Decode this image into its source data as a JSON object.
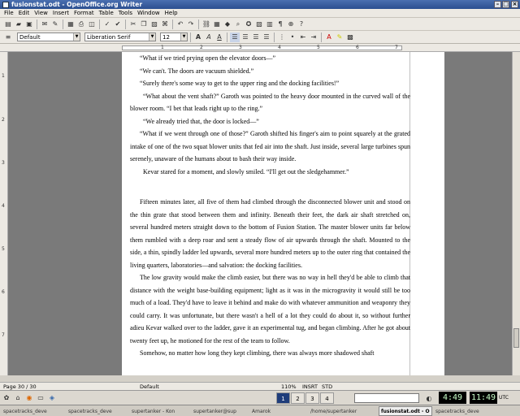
{
  "window": {
    "title": "fusionstat.odt - OpenOffice.org Writer"
  },
  "menu": [
    "File",
    "Edit",
    "View",
    "Insert",
    "Format",
    "Table",
    "Tools",
    "Window",
    "Help"
  ],
  "format": {
    "style": "Default",
    "font": "Liberation Serif",
    "size": "12"
  },
  "ruler_numbers": [
    "1",
    "2",
    "3",
    "4",
    "5",
    "6",
    "7"
  ],
  "vruler_numbers": [
    "1",
    "2",
    "3",
    "4",
    "5",
    "6",
    "7"
  ],
  "document": {
    "paragraphs": [
      {
        "cls": "ind",
        "text": "“What if we tried prying open the elevator doors—”"
      },
      {
        "cls": "ind",
        "text": "“We can't. The doors are vacuum shielded.”"
      },
      {
        "cls": "ind",
        "text": "“Surely there's some way to get to the upper ring and the docking facilities!”"
      },
      {
        "cls": "ind2",
        "text": "“What about the vent shaft?” Garoth was pointed to the heavy door mounted in the curved wall of the blower room. “I bet that leads right up to the ring.”"
      },
      {
        "cls": "ind2",
        "text": "“We already tried that, the door is locked—”"
      },
      {
        "cls": "ind",
        "text": "“What if we went through one of those?” Garoth shifted his finger's aim to point squarely at the grated intake of one of the two squat blower units that fed air into the shaft. Just inside, several large turbines spun serenely, unaware of the humans about to bash their way inside."
      },
      {
        "cls": "ind2",
        "text": "Kevar stared for a moment, and slowly smiled. “I'll get out the sledgehammer.”"
      },
      {
        "cls": "gap",
        "text": ""
      },
      {
        "cls": "ind",
        "text": "Fifteen minutes later, all five of them had climbed through the disconnected blower unit and stood on the thin grate that stood between them and infinity. Beneath their feet, the dark air shaft stretched on, several hundred meters straight down to the bottom of Fusion Station. The master blower units far below them rumbled with a deep roar and sent a steady flow of air upwards through the shaft. Mounted to the side, a thin, spindly ladder led upwards, several more hundred meters up to the outer ring that contained the living quarters, laboratories—and salvation: the docking facilities."
      },
      {
        "cls": "ind",
        "text": "The low gravity would make the climb easier, but there was no way in hell they'd be able to climb that distance with the weight base-building equipment; light as it was in the microgravity it would still be too much of a load. They'd have to leave it behind and make do with whatever ammunition and weaponry they could carry. It was unfortunate, but there wasn't a hell of a lot they could do about it, so without further adieu Kevar walked over to the ladder, gave it an experimental tug, and began climbing. After he got about twenty feet up, he motioned for the rest of the team to follow."
      },
      {
        "cls": "ind",
        "text": "Somehow, no matter how long they kept climbing, there was always more shadowed shaft"
      }
    ]
  },
  "status": {
    "page": "Page 30 / 30",
    "style": "Default",
    "zoom": "110%",
    "insert": "INSRT",
    "selmode": "STD"
  },
  "panel": {
    "desktops": [
      "1",
      "2",
      "3",
      "4"
    ],
    "clock1": "4:49",
    "clock2": "11:49",
    "tz": "UTC"
  },
  "taskbar": [
    {
      "label": "spacetracks_deve",
      "active": false
    },
    {
      "label": "spacetracks_deve",
      "active": false
    },
    {
      "label": "supertanker - Kon",
      "active": false
    },
    {
      "label": "supertanker@sup",
      "active": false
    },
    {
      "label": "Amarok",
      "active": false
    },
    {
      "label": "/home/supertanker",
      "active": false
    },
    {
      "label": "fusionstat.odt - O",
      "active": true
    },
    {
      "label": "spacetracks_deve",
      "active": false
    }
  ]
}
